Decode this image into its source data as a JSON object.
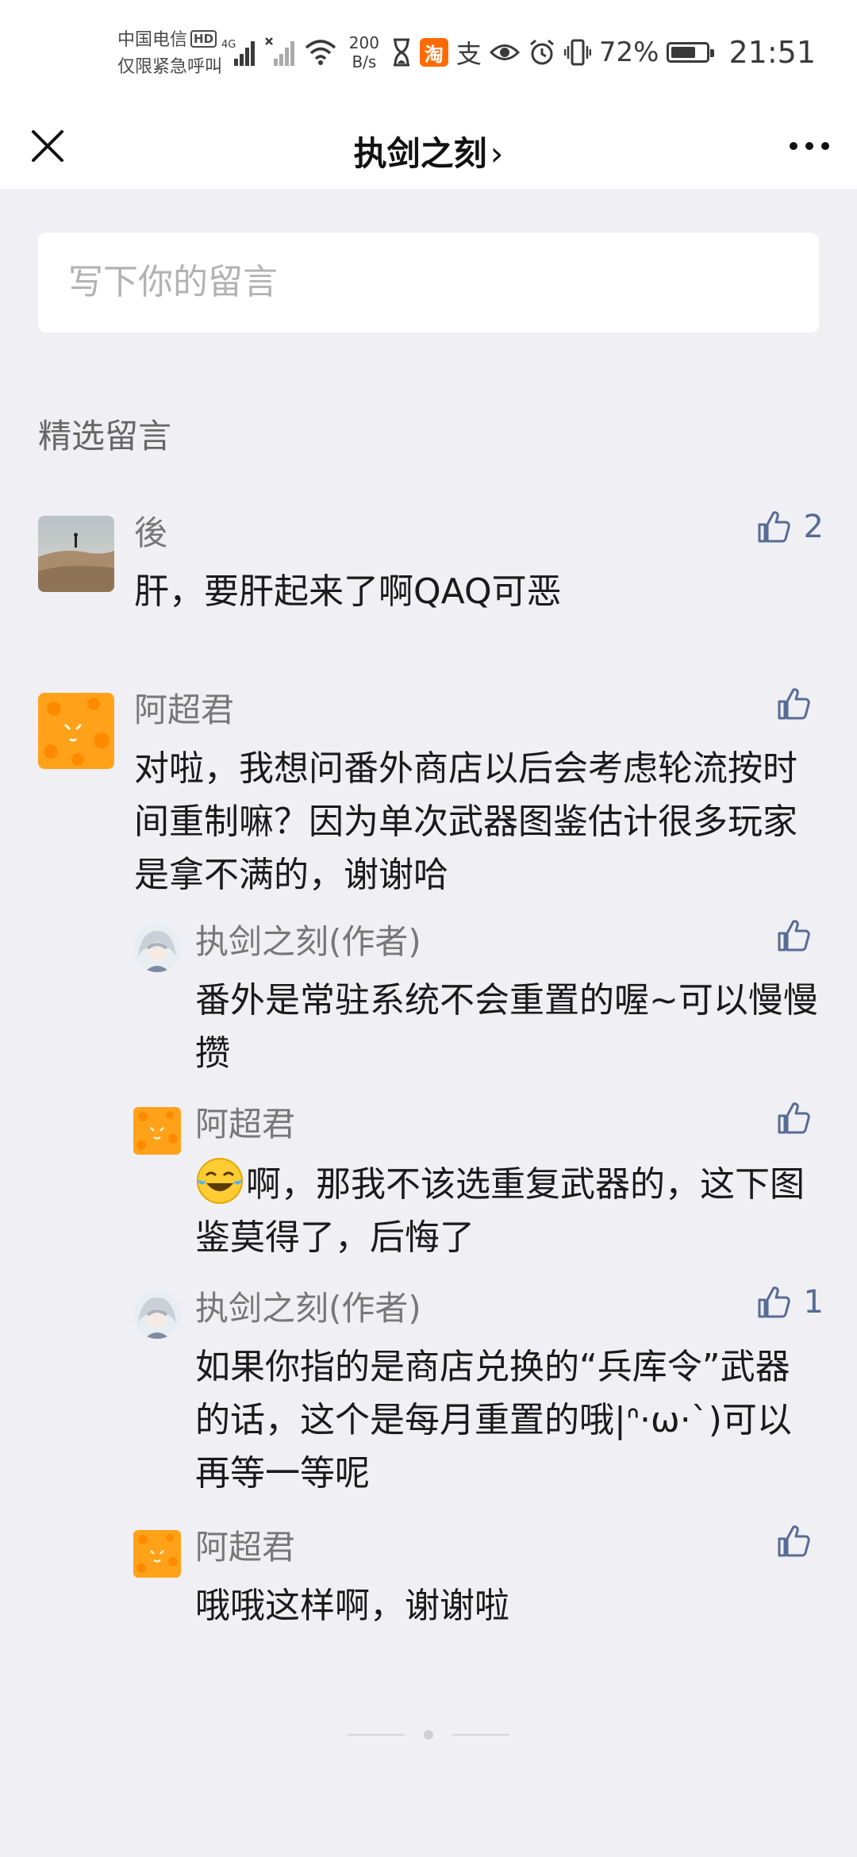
{
  "status_bar": {
    "carrier": "中国电信",
    "hd_badge": "HD",
    "emergency": "仅限紧急呼叫",
    "net_badge": "4G",
    "speed_value": "200",
    "speed_unit": "B/s",
    "taobao_glyph": "淘",
    "alipay_glyph": "支",
    "battery_pct": "72%",
    "battery_level": 0.72,
    "time": "21:51"
  },
  "nav": {
    "title": "执剑之刻",
    "chevron": "›"
  },
  "comment_input": {
    "placeholder": "写下你的留言"
  },
  "section": {
    "title": "精选留言"
  },
  "comments": [
    {
      "name": "後",
      "text": "肝，要肝起来了啊QAQ可恶",
      "likes": "2"
    },
    {
      "name": "阿超君",
      "text": "对啦，我想问番外商店以后会考虑轮流按时间重制嘛？因为单次武器图鉴估计很多玩家是拿不满的，谢谢哈",
      "likes": "",
      "replies": [
        {
          "name": "执剑之刻(作者)",
          "text": "番外是常驻系统不会重置的喔~可以慢慢攒",
          "likes": ""
        },
        {
          "name": "阿超君",
          "text": "啊，那我不该选重复武器的，这下图鉴莫得了，后悔了",
          "likes": "",
          "leading_emoji": "face-with-tears-of-joy"
        },
        {
          "name": "执剑之刻(作者)",
          "text": "如果你指的是商店兑换的“兵库令”武器的话，这个是每月重置的哦|ᐢ·ω·`)可以再等一等呢",
          "likes": "1"
        },
        {
          "name": "阿超君",
          "text": "哦哦这样啊，谢谢啦",
          "likes": ""
        }
      ]
    }
  ],
  "colors": {
    "page_bg": "#efeff4",
    "like_blue": "#576b95",
    "taobao_orange": "#ff6a00"
  }
}
